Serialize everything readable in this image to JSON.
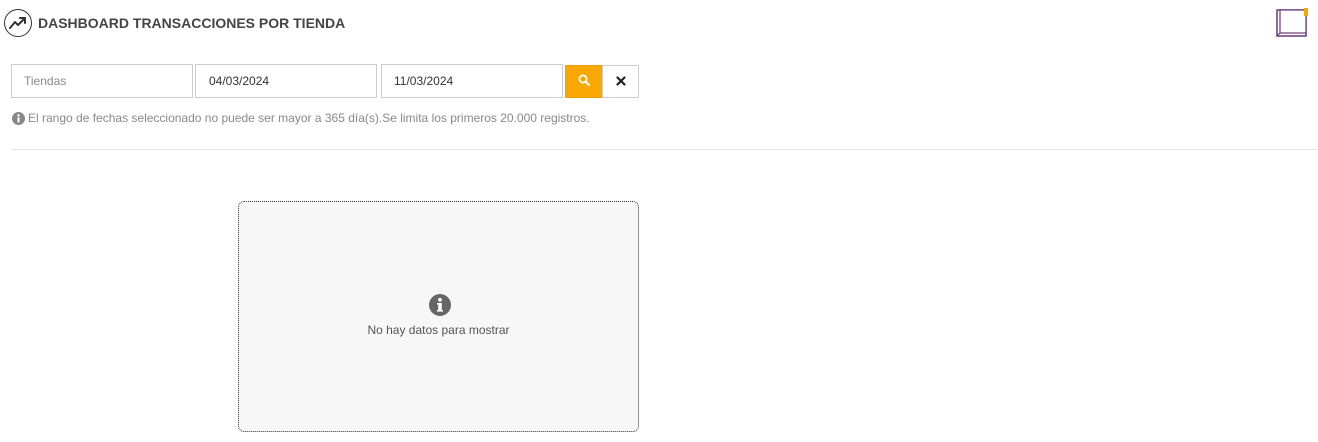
{
  "header": {
    "title": "DASHBOARD TRANSACCIONES POR TIENDA",
    "icon": "trend-chart-icon",
    "manual_icon": "book-icon"
  },
  "filters": {
    "store_placeholder": "Tiendas",
    "store_value": "",
    "date_from": "04/03/2024",
    "date_to": "11/03/2024",
    "search_icon": "search-icon",
    "clear_icon": "close-icon"
  },
  "hint": {
    "text": "El rango de fechas seleccionado no puede ser mayor a 365 día(s).Se limita los primeros 20.000 registros.",
    "icon": "info-icon"
  },
  "empty_state": {
    "message": "No hay datos para mostrar",
    "icon": "info-icon"
  },
  "colors": {
    "accent": "#f9a803",
    "book_icon": "#6b3a78",
    "book_marker": "#f9a803"
  }
}
